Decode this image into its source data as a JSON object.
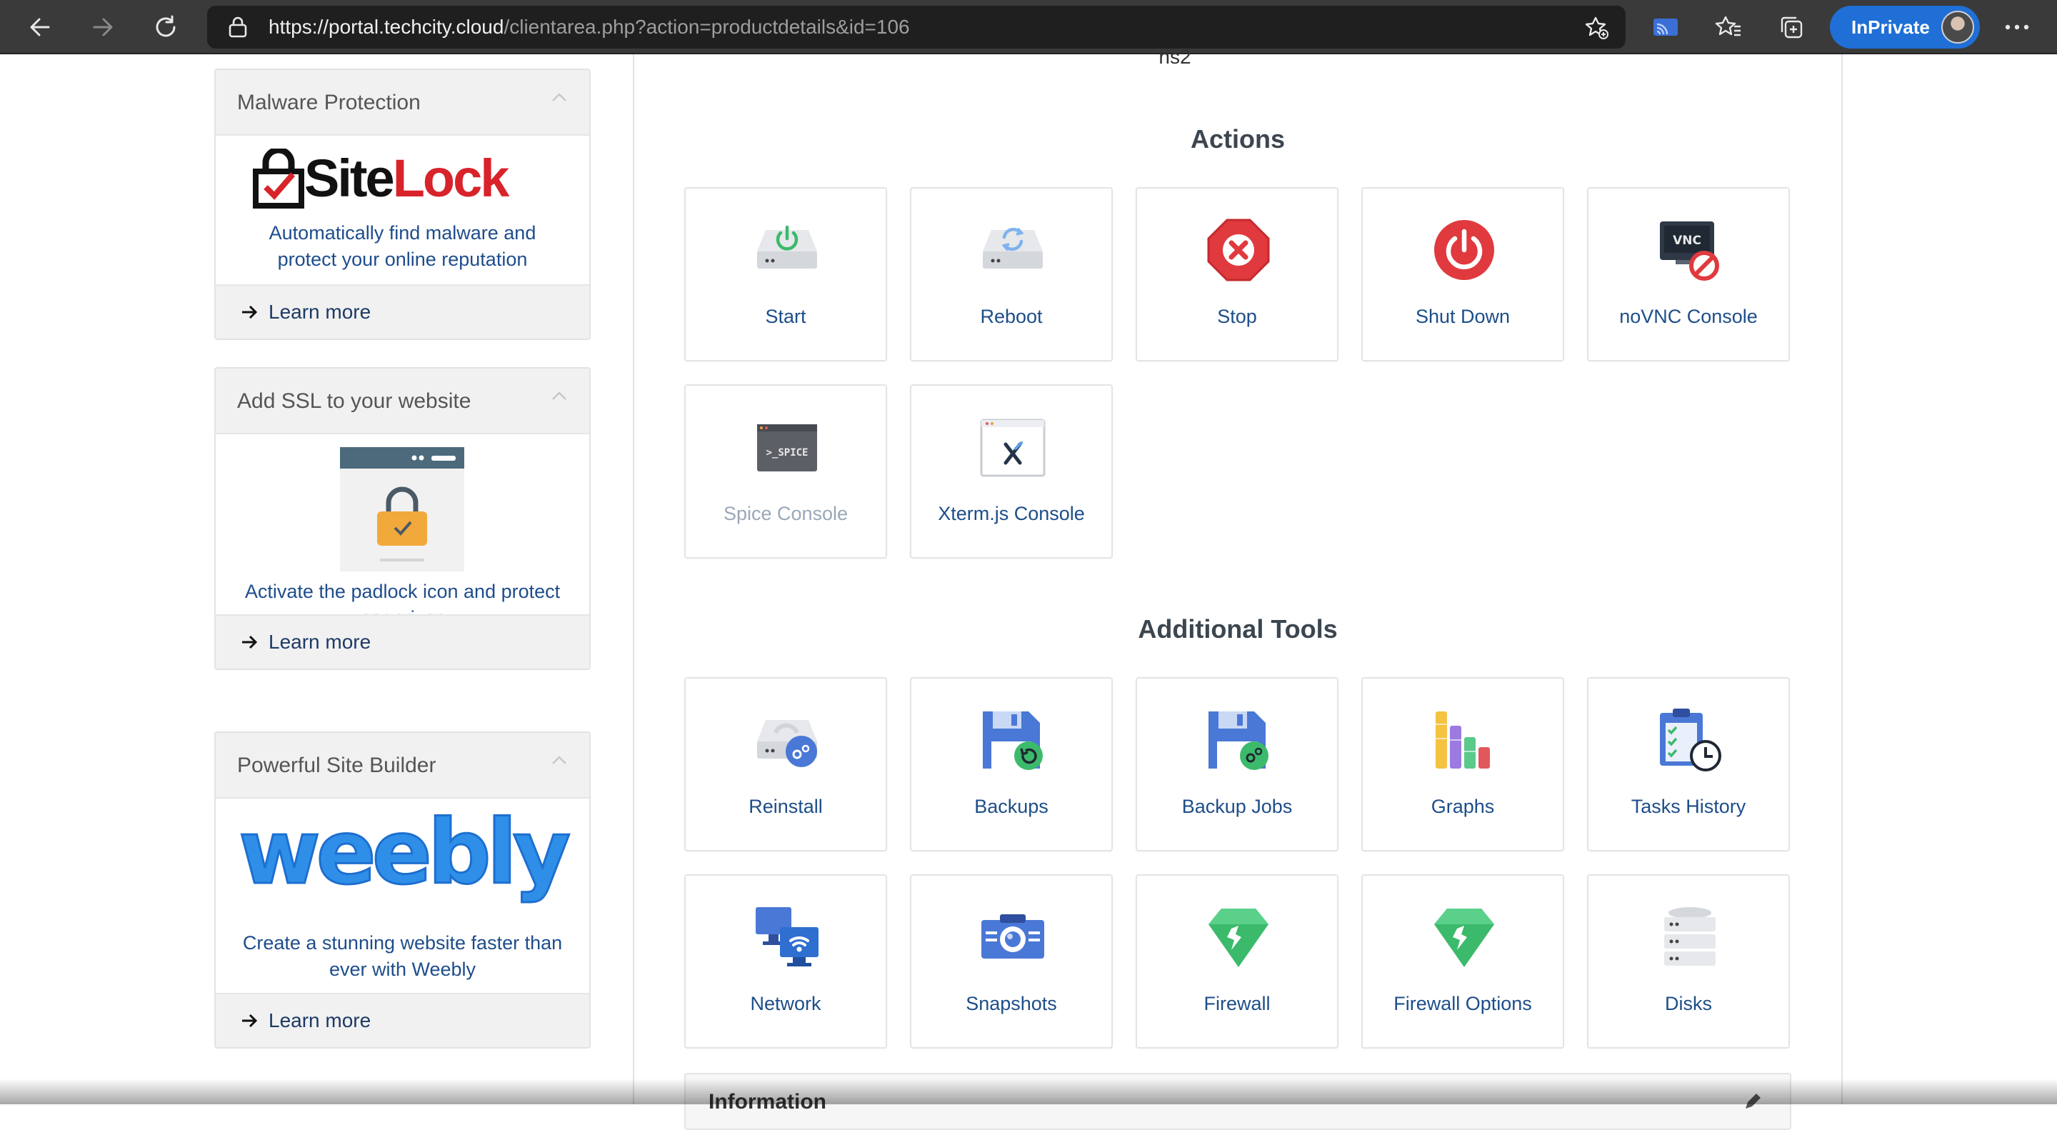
{
  "browser": {
    "url_host": "https://portal.techcity.cloud",
    "url_path": "/clientarea.php?action=productdetails&id=106",
    "inprivate_label": "InPrivate"
  },
  "top_fragment": "ns2",
  "sidebar": {
    "cards": [
      {
        "title": "Malware Protection",
        "logo_text_site": "Site",
        "logo_text_lock": "Lock",
        "description": [
          "Automatically find malware and",
          "protect your online reputation"
        ],
        "learn_more": "Learn more"
      },
      {
        "title": "Add SSL to your website",
        "description": [
          "Activate the padlock icon and protect",
          "user privacy"
        ],
        "learn_more": "Learn more"
      },
      {
        "title": "Powerful Site Builder",
        "logo_text": "weebly",
        "description": [
          "Create a stunning website faster than",
          "ever with Weebly"
        ],
        "learn_more": "Learn more"
      }
    ]
  },
  "actions": {
    "title": "Actions",
    "tiles": [
      {
        "label": "Start",
        "icon": "server-power-icon",
        "enabled": true
      },
      {
        "label": "Reboot",
        "icon": "server-reboot-icon",
        "enabled": true
      },
      {
        "label": "Stop",
        "icon": "stop-icon",
        "enabled": true
      },
      {
        "label": "Shut Down",
        "icon": "power-icon",
        "enabled": true
      },
      {
        "label": "noVNC Console",
        "icon": "vnc-console-icon",
        "enabled": true
      },
      {
        "label": "Spice Console",
        "icon": "spice-console-icon",
        "enabled": false
      },
      {
        "label": "Xterm.js Console",
        "icon": "xterm-console-icon",
        "enabled": true
      }
    ]
  },
  "additional_tools": {
    "title": "Additional Tools",
    "tiles": [
      {
        "label": "Reinstall",
        "icon": "reinstall-icon"
      },
      {
        "label": "Backups",
        "icon": "backups-icon"
      },
      {
        "label": "Backup Jobs",
        "icon": "backup-jobs-icon"
      },
      {
        "label": "Graphs",
        "icon": "graphs-icon"
      },
      {
        "label": "Tasks History",
        "icon": "tasks-history-icon"
      },
      {
        "label": "Network",
        "icon": "network-icon"
      },
      {
        "label": "Snapshots",
        "icon": "snapshots-icon"
      },
      {
        "label": "Firewall",
        "icon": "firewall-icon"
      },
      {
        "label": "Firewall Options",
        "icon": "firewall-options-icon"
      },
      {
        "label": "Disks",
        "icon": "disks-icon"
      }
    ]
  },
  "information": {
    "title": "Information"
  },
  "colors": {
    "link_blue": "#1d4e89",
    "accent_blue": "#1f6fd6",
    "stop_red": "#e03a3e",
    "firewall_green": "#3cba6b"
  }
}
